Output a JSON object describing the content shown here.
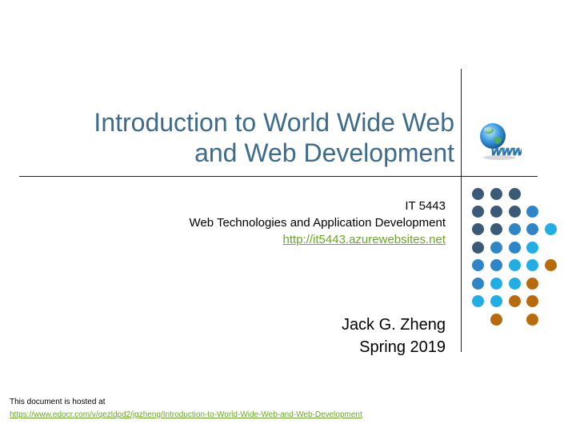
{
  "title": {
    "line1": "Introduction to World Wide Web",
    "line2": "and Web Development"
  },
  "course": {
    "code": "IT 5443",
    "name": "Web Technologies and Application Development",
    "link": "http://it5443.azurewebsites.net"
  },
  "author": {
    "name": "Jack G. Zheng",
    "term": "Spring 2019"
  },
  "footer": {
    "note": "This document is hosted at",
    "link": "https://www.edocr.com/v/qezldpd2/jgzheng/Introduction-to-World-Wide-Web-and-Web-Development"
  },
  "icons": {
    "www": "globe-www-icon"
  },
  "colors": {
    "title": "#3c6b8c",
    "link": "#6aa629",
    "dot_dark": "#3a5a78",
    "dot_blue": "#2e86c8",
    "dot_light": "#22aee5",
    "dot_orange": "#b86b0c"
  }
}
